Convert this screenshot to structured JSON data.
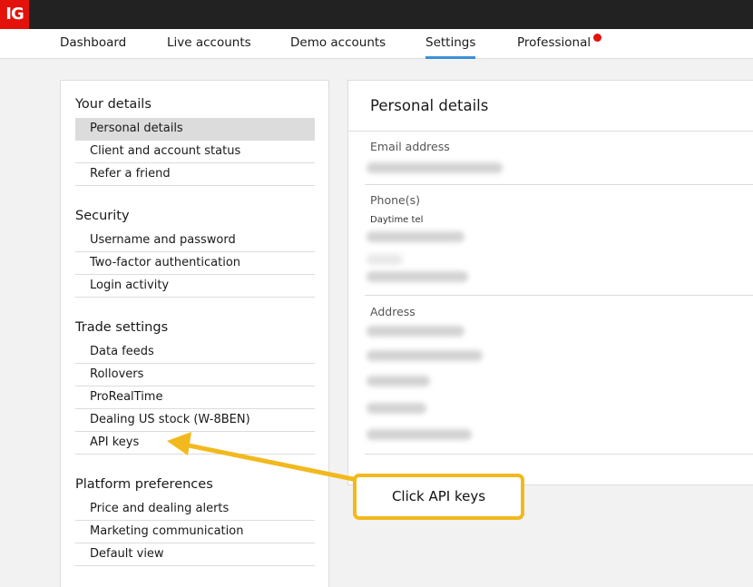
{
  "brand": {
    "logo_text": "IG"
  },
  "nav": {
    "items": [
      {
        "label": "Dashboard"
      },
      {
        "label": "Live accounts"
      },
      {
        "label": "Demo accounts"
      },
      {
        "label": "Settings"
      },
      {
        "label": "Professional"
      }
    ],
    "active": "Settings"
  },
  "sidebar": {
    "sections": [
      {
        "title": "Your details",
        "items": [
          "Personal details",
          "Client and account status",
          "Refer a friend"
        ]
      },
      {
        "title": "Security",
        "items": [
          "Username and password",
          "Two-factor authentication",
          "Login activity"
        ]
      },
      {
        "title": "Trade settings",
        "items": [
          "Data feeds",
          "Rollovers",
          "ProRealTime",
          "Dealing US stock (W-8BEN)",
          "API keys"
        ]
      },
      {
        "title": "Platform preferences",
        "items": [
          "Price and dealing alerts",
          "Marketing communication",
          "Default view"
        ]
      }
    ],
    "selected": "Personal details"
  },
  "panel": {
    "title": "Personal details",
    "email_label": "Email address",
    "phone_label": "Phone(s)",
    "daytime_label": "Daytime tel",
    "address_label": "Address"
  },
  "annotation": {
    "text": "Click API keys"
  },
  "colors": {
    "accent": "#3d8fd8",
    "brand": "#e3120b",
    "callout": "#f2b91e"
  }
}
